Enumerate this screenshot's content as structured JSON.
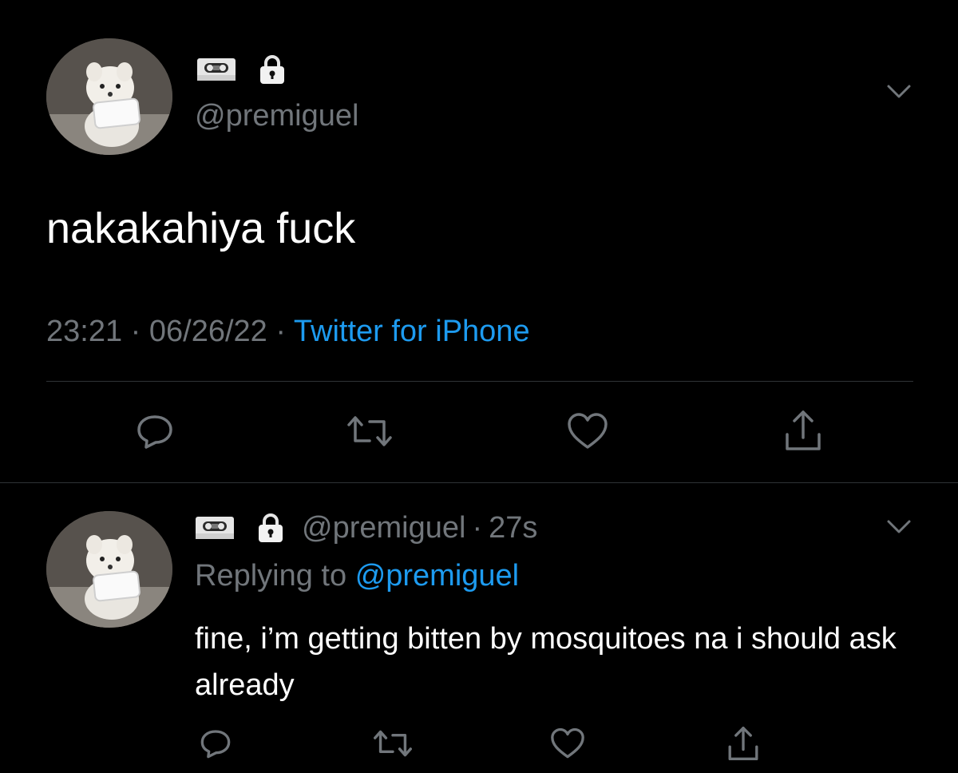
{
  "main_tweet": {
    "handle": "@premiguel",
    "name_emojis": [
      "videocassette-icon",
      "lock-icon"
    ],
    "text": "nakakahiya fuck",
    "time": "23:21",
    "separator": "·",
    "date": "06/26/22",
    "source": "Twitter for iPhone",
    "actions": [
      "reply-icon",
      "retweet-icon",
      "like-icon",
      "share-icon"
    ]
  },
  "reply_tweet": {
    "handle": "@premiguel",
    "separator": "·",
    "age": "27s",
    "replying_prefix": "Replying to",
    "replying_handle": "@premiguel",
    "text": "fine, i’m getting bitten by mosquitoes na i should ask already",
    "actions": [
      "reply-icon",
      "retweet-icon",
      "like-icon",
      "share-icon"
    ]
  },
  "colors": {
    "background": "#000000",
    "text": "#ffffff",
    "muted": "#71767b",
    "link": "#1d9bf0",
    "divider": "#2f3336"
  }
}
